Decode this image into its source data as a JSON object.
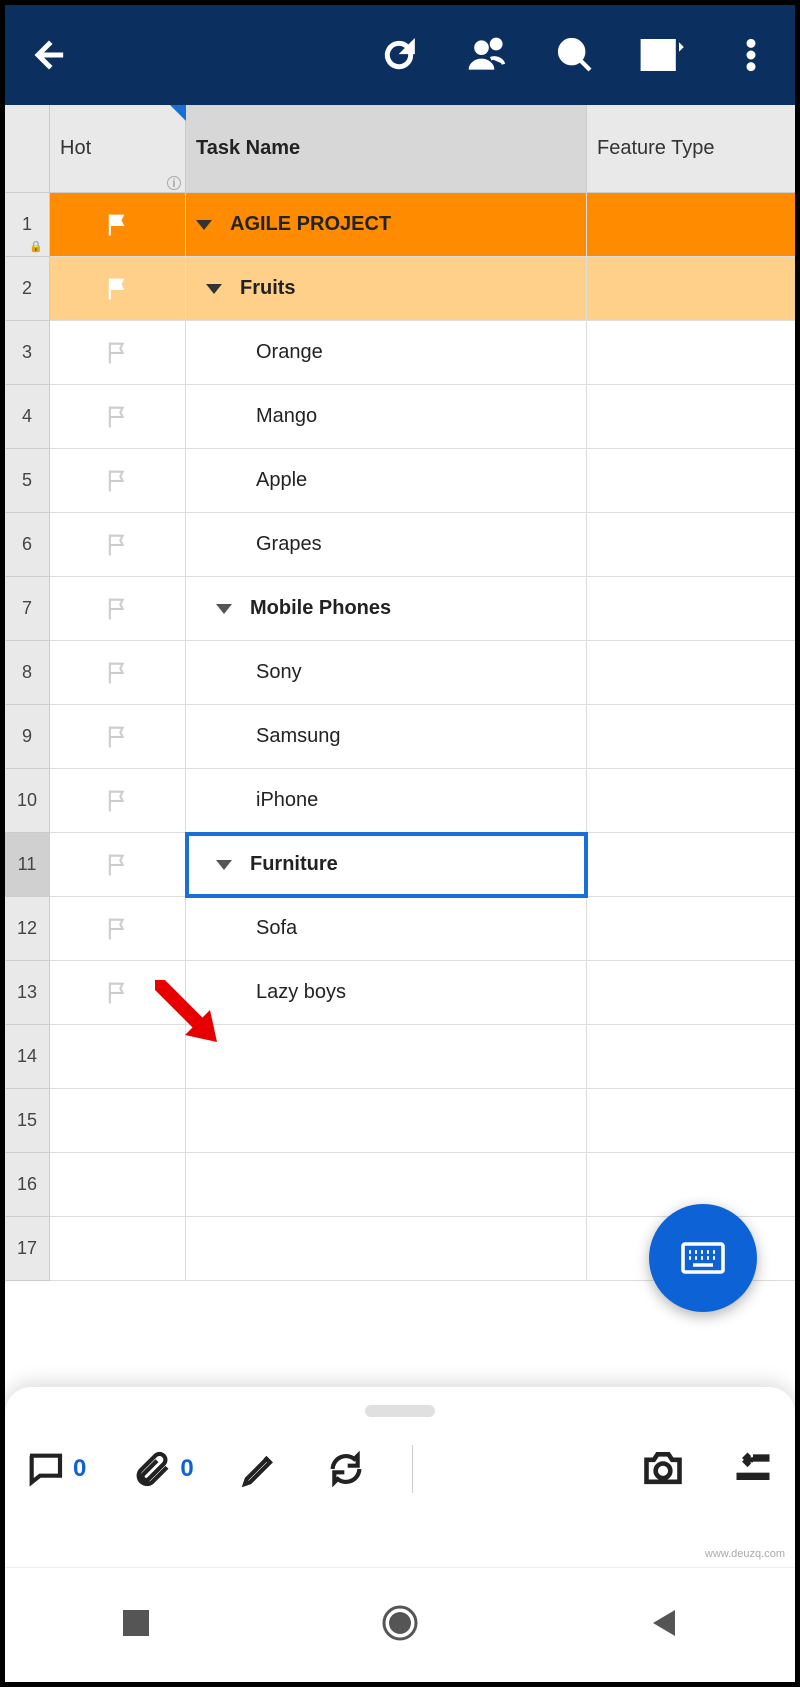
{
  "columns": {
    "hot": "Hot",
    "task": "Task Name",
    "feature": "Feature Type"
  },
  "rows": [
    {
      "num": 1,
      "level": 0,
      "flag": "white",
      "expand": true,
      "label": "AGILE PROJECT",
      "lock": true
    },
    {
      "num": 2,
      "level": 1,
      "flag": "white",
      "expand": true,
      "label": "Fruits"
    },
    {
      "num": 3,
      "level": 3,
      "flag": "gray",
      "label": "Orange"
    },
    {
      "num": 4,
      "level": 3,
      "flag": "gray",
      "label": "Mango"
    },
    {
      "num": 5,
      "level": 3,
      "flag": "gray",
      "label": "Apple"
    },
    {
      "num": 6,
      "level": 3,
      "flag": "gray",
      "label": "Grapes"
    },
    {
      "num": 7,
      "level": 2,
      "flag": "gray",
      "expand": true,
      "label": "Mobile Phones"
    },
    {
      "num": 8,
      "level": 3,
      "flag": "gray",
      "label": "Sony"
    },
    {
      "num": 9,
      "level": 3,
      "flag": "gray",
      "label": "Samsung"
    },
    {
      "num": 10,
      "level": 3,
      "flag": "gray",
      "label": "iPhone"
    },
    {
      "num": 11,
      "level": 2,
      "flag": "gray",
      "expand": true,
      "label": "Furniture",
      "selected": true
    },
    {
      "num": 12,
      "level": 3,
      "flag": "gray",
      "label": "Sofa"
    },
    {
      "num": 13,
      "level": 3,
      "flag": "gray",
      "label": "Lazy boys"
    },
    {
      "num": 14,
      "level": 3,
      "label": ""
    },
    {
      "num": 15,
      "level": 3,
      "label": ""
    },
    {
      "num": 16,
      "level": 3,
      "label": ""
    },
    {
      "num": 17,
      "level": 3,
      "label": ""
    }
  ],
  "sheet": {
    "comments": 0,
    "attachments": 0
  },
  "watermark": "www.deuzq.com"
}
